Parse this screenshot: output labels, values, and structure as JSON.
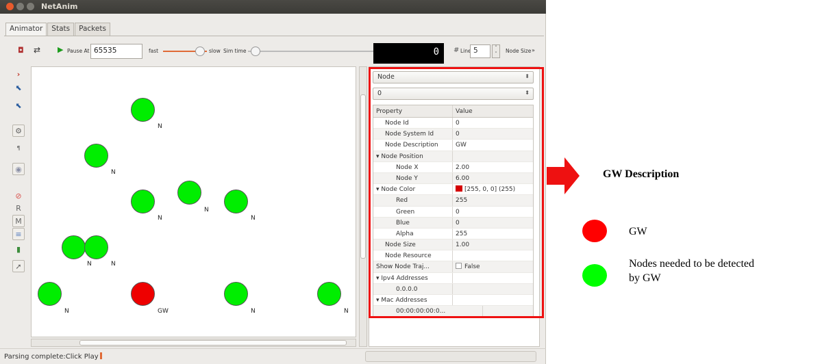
{
  "window": {
    "title": "NetAnim"
  },
  "tabs": [
    "Animator",
    "Stats",
    "Packets"
  ],
  "toolbar": {
    "pause_at_label": "Pause At",
    "pause_at_value": "65535",
    "fast_label": "fast",
    "slow_label": "slow",
    "sim_time_label": "Sim time",
    "lcd_value": "0",
    "lines_label": "Lines",
    "lines_value": "5",
    "node_size_label": "Node Size"
  },
  "left_tools": {
    "r_label": "R",
    "m_label": "M"
  },
  "nodes": [
    {
      "label": "N",
      "color": "#00ee00"
    },
    {
      "label": "N",
      "color": "#00ee00"
    },
    {
      "label": "N",
      "color": "#00ee00"
    },
    {
      "label": "N",
      "color": "#00ee00"
    },
    {
      "label": "N",
      "color": "#00ee00"
    },
    {
      "label": "N",
      "color": "#00ee00"
    },
    {
      "label": "N",
      "color": "#00ee00"
    },
    {
      "label": "N",
      "color": "#00ee00"
    },
    {
      "label": "GW",
      "color": "#ee0000"
    },
    {
      "label": "N",
      "color": "#00ee00"
    },
    {
      "label": "N",
      "color": "#00ee00"
    }
  ],
  "panel": {
    "type_select": "Node",
    "id_select": "0",
    "header": {
      "property": "Property",
      "value": "Value"
    },
    "rows": [
      {
        "k": "Node Id",
        "v": "0"
      },
      {
        "k": "Node System Id",
        "v": "0"
      },
      {
        "k": "Node Description",
        "v": "GW"
      },
      {
        "k": "▾ Node Position",
        "v": ""
      },
      {
        "k": "Node X",
        "v": "2.00"
      },
      {
        "k": "Node Y",
        "v": "6.00"
      },
      {
        "k": "▾ Node Color",
        "v": "[255, 0, 0] (255)"
      },
      {
        "k": "Red",
        "v": "255"
      },
      {
        "k": "Green",
        "v": "0"
      },
      {
        "k": "Blue",
        "v": "0"
      },
      {
        "k": "Alpha",
        "v": "255"
      },
      {
        "k": "Node Size",
        "v": "1.00"
      },
      {
        "k": "Node Resource",
        "v": ""
      },
      {
        "k": "Show Node Traj...",
        "v": "False"
      },
      {
        "k": "▾ Ipv4 Addresses",
        "v": ""
      },
      {
        "k": "0.0.0.0",
        "v": ""
      },
      {
        "k": "▾ Mac Addresses",
        "v": ""
      },
      {
        "k": "00:00:00:00:0...",
        "v": ""
      }
    ]
  },
  "status": {
    "text": "Parsing complete:Click Play"
  },
  "legend": {
    "title": "GW Description",
    "gw_label": "GW",
    "gw_color": "#ff0000",
    "nodes_label_line1": "Nodes needed to be detected",
    "nodes_label_line2": "by GW",
    "nodes_color": "#00ff00"
  }
}
